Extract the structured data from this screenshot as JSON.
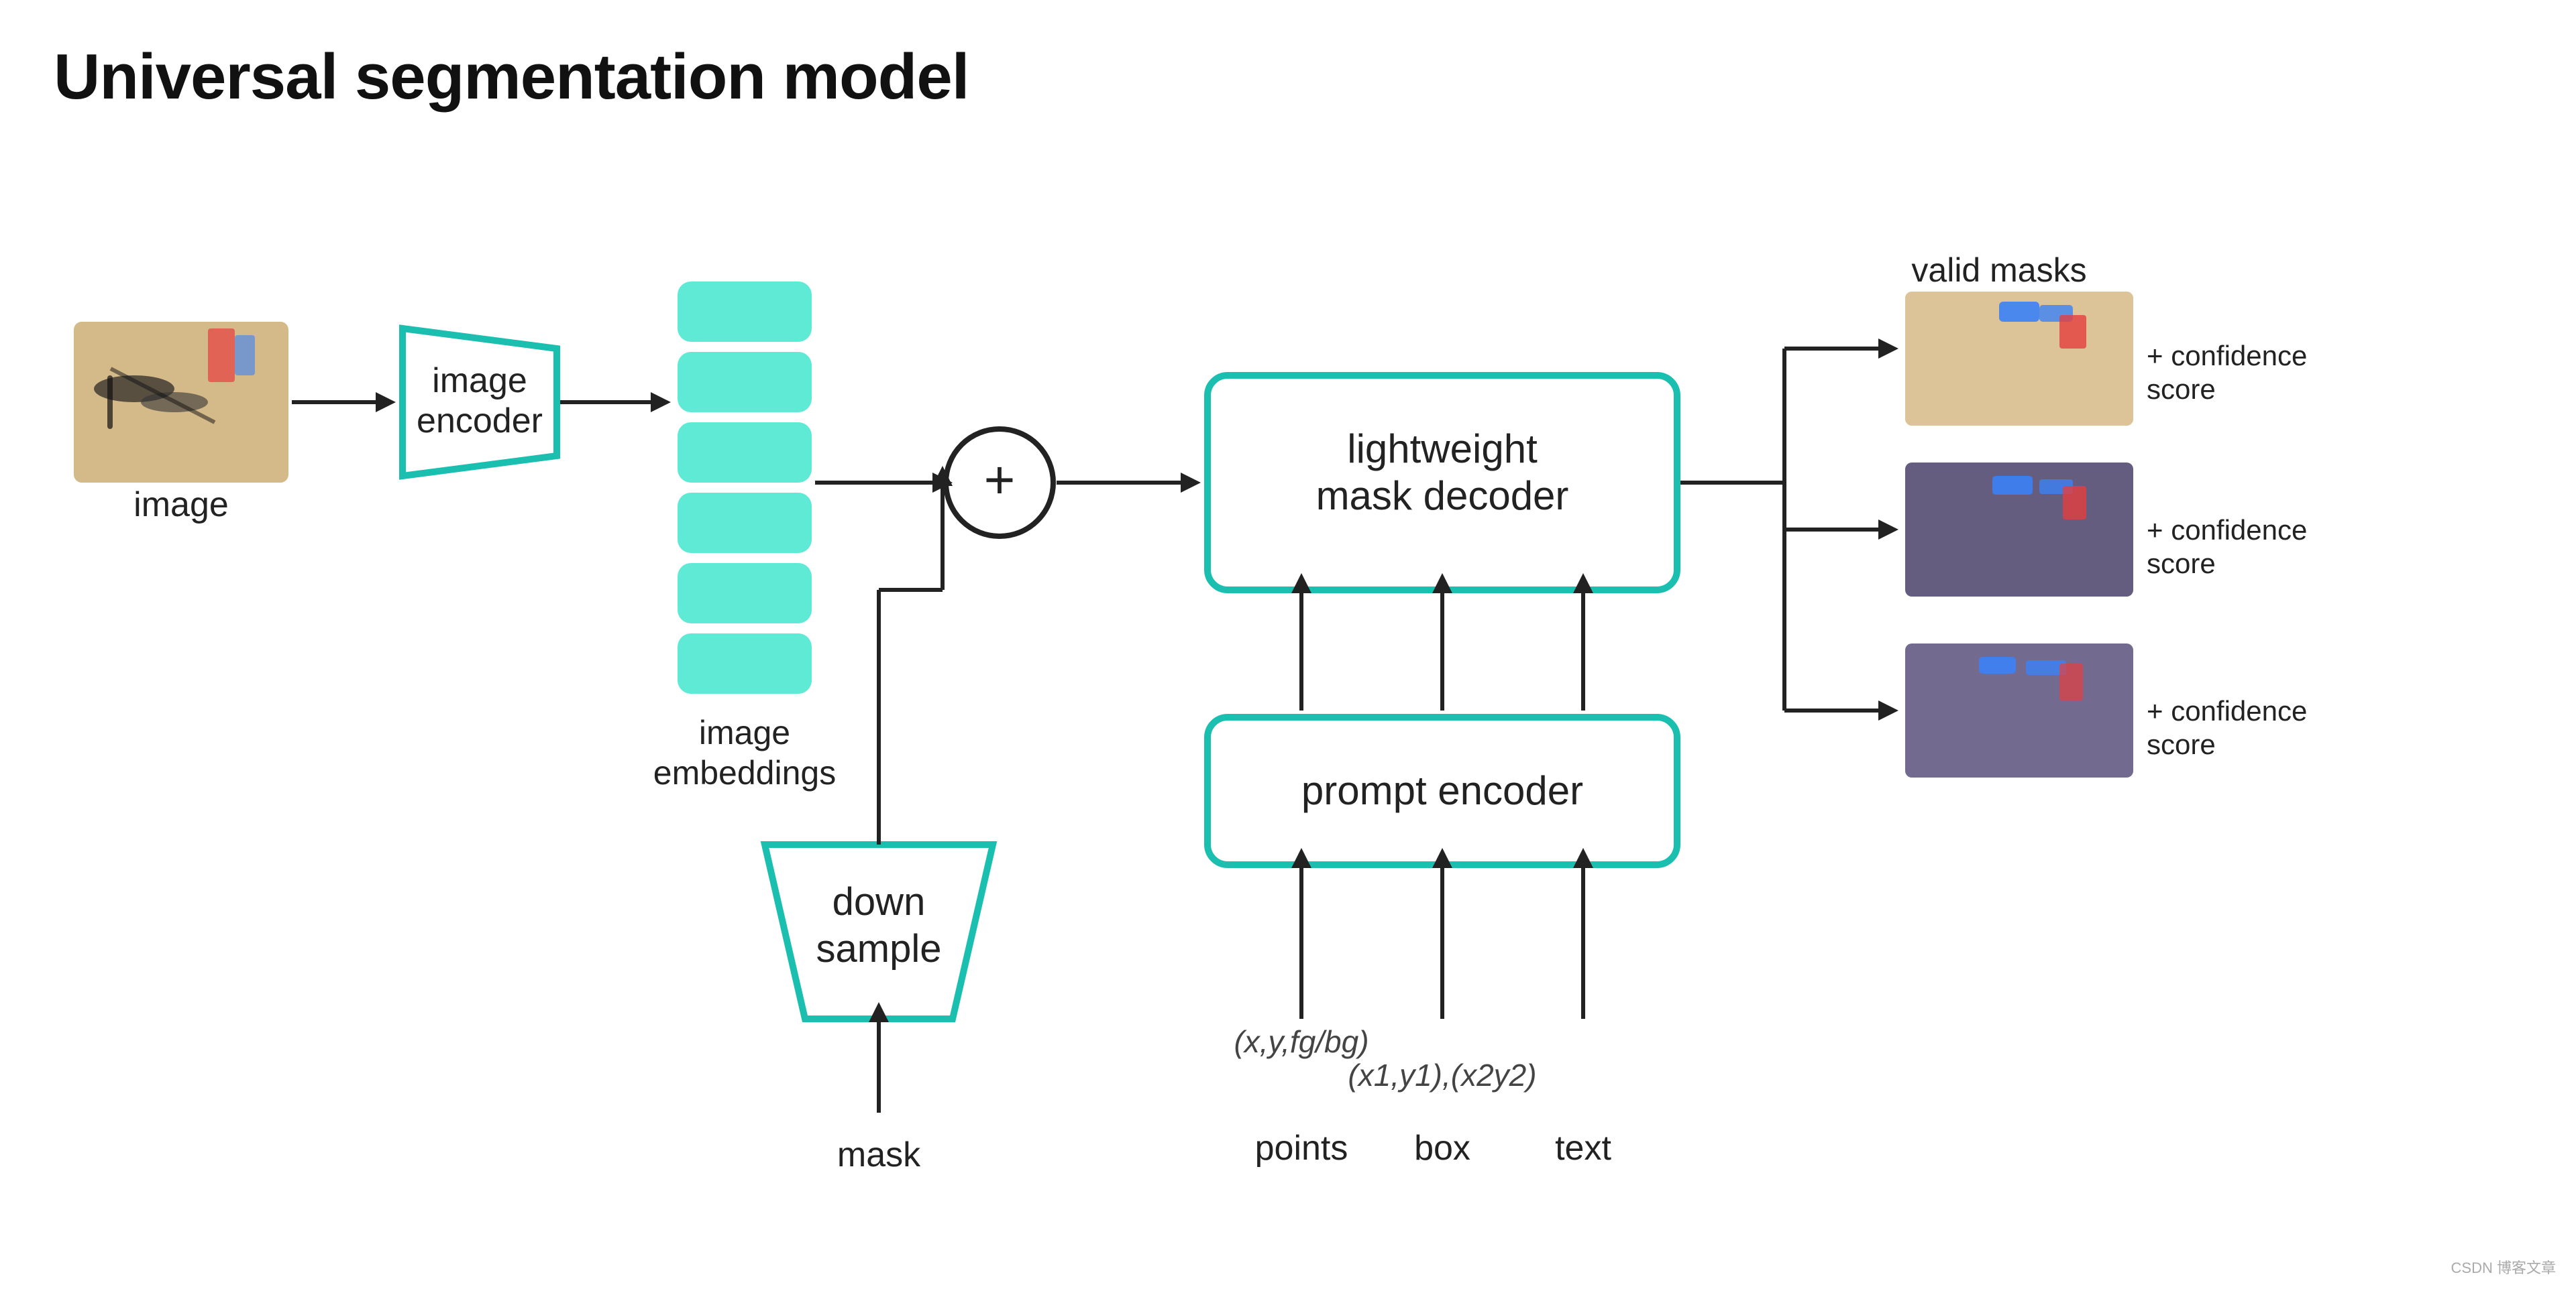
{
  "page": {
    "title": "Universal segmentation model",
    "background": "#ffffff"
  },
  "diagram": {
    "image_label": "image",
    "image_encoder_label": "image\nencoder",
    "image_embeddings_label": "image\nembeddings",
    "down_sample_label": "down\nsample",
    "mask_label": "mask",
    "lightweight_decoder_label": "lightweight\nmask decoder",
    "prompt_encoder_label": "prompt encoder",
    "points_label": "points",
    "box_label": "box",
    "text_label": "text",
    "points_formula": "(x,y,fg/bg)",
    "box_formula": "(x1,y1),(x2y2)",
    "valid_masks_label": "valid masks",
    "confidence_labels": [
      "confidence\nscore",
      "confidence\nscore",
      "confidence\nscore"
    ],
    "plus_sign": "+",
    "arrow_right": "→",
    "teal_color": "#2dd4c4",
    "teal_border": "#1bbfb0"
  },
  "watermark": {
    "text": "CSDN 博客文章"
  }
}
